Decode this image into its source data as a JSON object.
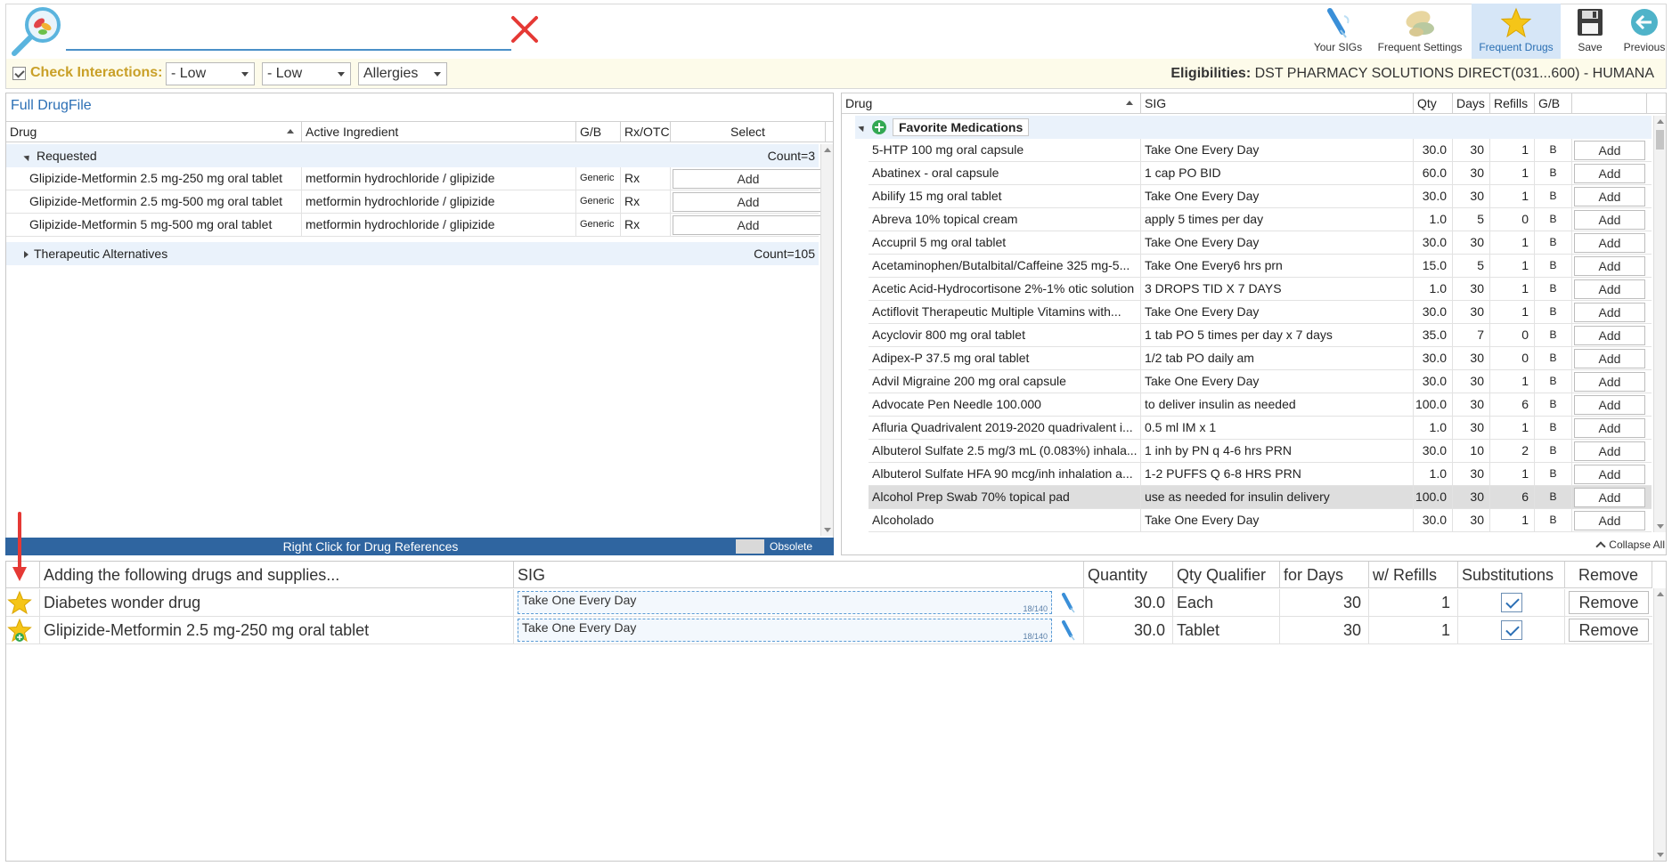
{
  "toolbar": {
    "buttons": [
      {
        "label": "Your SIGs",
        "icon": "syringe-pen-icon"
      },
      {
        "label": "Frequent Settings",
        "icon": "pills-icon"
      },
      {
        "label": "Frequent Drugs",
        "icon": "star-icon",
        "active": true
      },
      {
        "label": "Save",
        "icon": "floppy-disk-icon"
      },
      {
        "label": "Previous",
        "icon": "back-arrow-icon"
      }
    ]
  },
  "search": {
    "value": ""
  },
  "interactions": {
    "label": "Check Interactions:",
    "checked": true,
    "dropdowns": [
      "- Low",
      "- Low",
      "Allergies"
    ]
  },
  "eligibility": {
    "label": "Eligibilities:",
    "value": "DST PHARMACY SOLUTIONS DIRECT(031...600) - HUMANA"
  },
  "left": {
    "title": "Full DrugFile",
    "headers": {
      "drug": "Drug",
      "ingredient": "Active Ingredient",
      "gb": "G/B",
      "rxotc": "Rx/OTC",
      "select": "Select"
    },
    "requested": {
      "label": "Requested",
      "count": "Count=3"
    },
    "rows": [
      {
        "drug": "Glipizide-Metformin 2.5 mg-250 mg oral tablet",
        "ingredient": "metformin hydrochloride / glipizide",
        "gb": "Generic",
        "rxotc": "Rx",
        "action": "Add"
      },
      {
        "drug": "Glipizide-Metformin 2.5 mg-500 mg oral tablet",
        "ingredient": "metformin hydrochloride / glipizide",
        "gb": "Generic",
        "rxotc": "Rx",
        "action": "Add"
      },
      {
        "drug": "Glipizide-Metformin 5 mg-500 mg oral tablet",
        "ingredient": "metformin hydrochloride / glipizide",
        "gb": "Generic",
        "rxotc": "Rx",
        "action": "Add"
      }
    ],
    "alternatives": {
      "label": "Therapeutic Alternatives",
      "count": "Count=105"
    },
    "reference_bar": "Right Click for Drug References",
    "obsolete_label": "Obsolete drug"
  },
  "right": {
    "headers": {
      "drug": "Drug",
      "sig": "SIG",
      "qty": "Qty",
      "days": "Days",
      "refills": "Refills",
      "gb": "G/B"
    },
    "group": "Favorite Medications",
    "rows": [
      {
        "drug": "5-HTP 100 mg oral capsule",
        "sig": "Take One Every Day",
        "qty": "30.0",
        "days": "30",
        "refills": "1",
        "gb": "B"
      },
      {
        "drug": "Abatinex - oral capsule",
        "sig": "1 cap PO BID",
        "qty": "60.0",
        "days": "30",
        "refills": "1",
        "gb": "B"
      },
      {
        "drug": "Abilify 15 mg oral tablet",
        "sig": "Take One Every Day",
        "qty": "30.0",
        "days": "30",
        "refills": "1",
        "gb": "B"
      },
      {
        "drug": "Abreva 10% topical cream",
        "sig": "apply 5 times per day",
        "qty": "1.0",
        "days": "5",
        "refills": "0",
        "gb": "B"
      },
      {
        "drug": "Accupril 5 mg oral tablet",
        "sig": "Take One Every Day",
        "qty": "30.0",
        "days": "30",
        "refills": "1",
        "gb": "B"
      },
      {
        "drug": "Acetaminophen/Butalbital/Caffeine 325 mg-5...",
        "sig": "Take One Every6 hrs prn",
        "qty": "15.0",
        "days": "5",
        "refills": "1",
        "gb": "B"
      },
      {
        "drug": "Acetic Acid-Hydrocortisone 2%-1% otic solution",
        "sig": "3 DROPS TID X 7 DAYS",
        "qty": "1.0",
        "days": "30",
        "refills": "1",
        "gb": "B"
      },
      {
        "drug": "Actiflovit Therapeutic Multiple Vitamins with...",
        "sig": "Take One Every Day",
        "qty": "30.0",
        "days": "30",
        "refills": "1",
        "gb": "B"
      },
      {
        "drug": "Acyclovir 800 mg oral tablet",
        "sig": "1 tab PO 5 times per day x 7 days",
        "qty": "35.0",
        "days": "7",
        "refills": "0",
        "gb": "B"
      },
      {
        "drug": "Adipex-P 37.5 mg oral tablet",
        "sig": "1/2 tab PO daily am",
        "qty": "30.0",
        "days": "30",
        "refills": "0",
        "gb": "B"
      },
      {
        "drug": "Advil Migraine 200 mg oral capsule",
        "sig": "Take One Every Day",
        "qty": "30.0",
        "days": "30",
        "refills": "1",
        "gb": "B"
      },
      {
        "drug": "Advocate Pen Needle 100.000",
        "sig": "to deliver insulin as needed",
        "qty": "100.0",
        "days": "30",
        "refills": "6",
        "gb": "B"
      },
      {
        "drug": "Afluria Quadrivalent 2019-2020 quadrivalent i...",
        "sig": "0.5 ml IM x 1",
        "qty": "1.0",
        "days": "30",
        "refills": "1",
        "gb": "B"
      },
      {
        "drug": "Albuterol Sulfate 2.5 mg/3 mL (0.083%) inhala...",
        "sig": "1 inh by PN q 4-6 hrs PRN",
        "qty": "30.0",
        "days": "10",
        "refills": "2",
        "gb": "B"
      },
      {
        "drug": "Albuterol Sulfate HFA 90 mcg/inh inhalation a...",
        "sig": "1-2 PUFFS Q 6-8 HRS PRN",
        "qty": "1.0",
        "days": "30",
        "refills": "1",
        "gb": "B"
      },
      {
        "drug": "Alcohol Prep Swab 70% topical pad",
        "sig": "use as needed for insulin delivery",
        "qty": "100.0",
        "days": "30",
        "refills": "6",
        "gb": "B",
        "selected": true
      },
      {
        "drug": "Alcoholado",
        "sig": "Take One Every Day",
        "qty": "30.0",
        "days": "30",
        "refills": "1",
        "gb": "B"
      }
    ],
    "add_label": "Add",
    "collapse_all": "Collapse All"
  },
  "bottom": {
    "headers": {
      "drug": "Adding the following drugs and supplies...",
      "sig": "SIG",
      "quantity": "Quantity",
      "qualifier": "Qty Qualifier",
      "days": "for Days",
      "refills": "w/ Refills",
      "subs": "Substitutions",
      "remove": "Remove"
    },
    "rows": [
      {
        "drug": "Diabetes wonder drug",
        "sig": "Take One Every Day",
        "sig_count": "18/140",
        "quantity": "30.0",
        "qualifier": "Each",
        "days": "30",
        "refills": "1",
        "subs": true,
        "remove": "Remove"
      },
      {
        "drug": "Glipizide-Metformin 2.5 mg-250 mg oral tablet",
        "sig": "Take One Every Day",
        "sig_count": "18/140",
        "quantity": "30.0",
        "qualifier": "Tablet",
        "days": "30",
        "refills": "1",
        "subs": true,
        "remove": "Remove"
      }
    ]
  },
  "colors": {
    "accent": "#2b6fb5",
    "ref_bar": "#2f65a0",
    "interaction_label": "#c9a028",
    "clear_x": "#e53935",
    "star": "#f5c518"
  }
}
